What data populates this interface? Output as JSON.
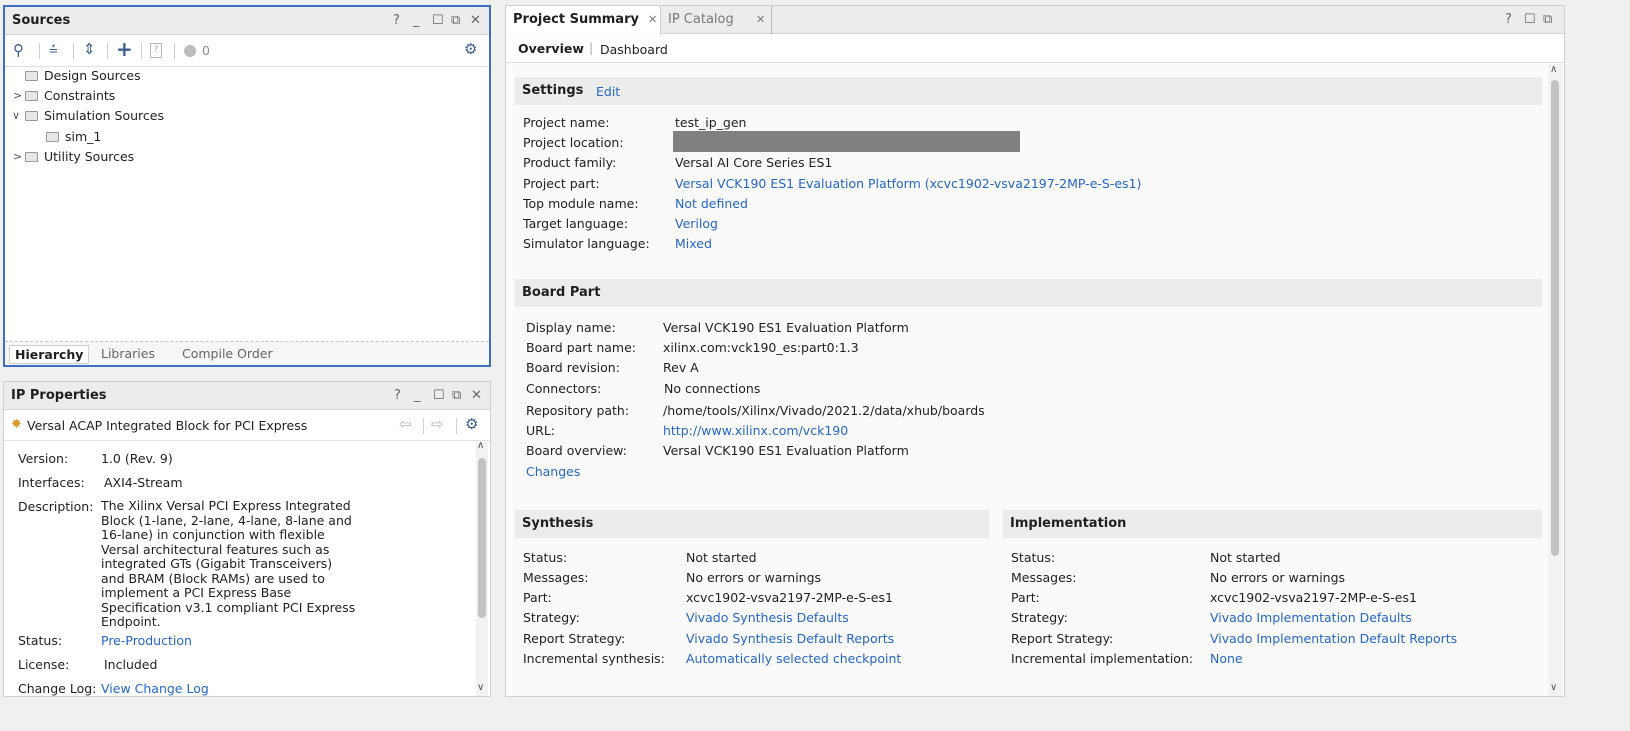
{
  "sources": {
    "title": "Sources",
    "badge_count": "0",
    "tree": [
      {
        "label": "Design Sources"
      },
      {
        "label": "Constraints"
      },
      {
        "label": "Simulation Sources"
      },
      {
        "label": "sim_1"
      },
      {
        "label": "Utility Sources"
      }
    ],
    "bottom_tabs": [
      "Hierarchy",
      "Libraries",
      "Compile Order"
    ]
  },
  "ip_properties": {
    "title": "IP Properties",
    "ip_name": "Versal ACAP Integrated Block for PCI Express",
    "version_label": "Version:",
    "version_value": "1.0 (Rev. 9)",
    "interfaces_label": "Interfaces:",
    "interfaces_value": "AXI4-Stream",
    "description_label": "Description:",
    "description_lines": [
      "The Xilinx Versal PCI Express Integrated",
      "Block (1-lane, 2-lane, 4-lane, 8-lane and",
      "16-lane) in conjunction with flexible",
      "Versal architectural features such as",
      "integrated GTs (Gigabit Transceivers)",
      "and BRAM (Block RAMs) are used to",
      "implement a PCI Express Base",
      "Specification v3.1 compliant PCI Express",
      "Endpoint."
    ],
    "status_label": "Status:",
    "status_value": "Pre-Production",
    "license_label": "License:",
    "license_value": "Included",
    "changelog_label": "Change Log:",
    "changelog_value": "View Change Log"
  },
  "main": {
    "tabs": [
      {
        "label": "Project Summary"
      },
      {
        "label": "IP Catalog"
      }
    ],
    "subtabs": [
      "Overview",
      "Dashboard"
    ],
    "settings": {
      "title": "Settings",
      "edit": "Edit",
      "rows": [
        {
          "label": "Project name:",
          "value": "test_ip_gen"
        },
        {
          "label": "Project location:",
          "value": ""
        },
        {
          "label": "Product family:",
          "value": "Versal AI Core Series ES1"
        },
        {
          "label": "Project part:",
          "value": "Versal VCK190 ES1 Evaluation Platform (xcvc1902-vsva2197-2MP-e-S-es1)"
        },
        {
          "label": "Top module name:",
          "value": "Not defined"
        },
        {
          "label": "Target language:",
          "value": "Verilog"
        },
        {
          "label": "Simulator language:",
          "value": "Mixed"
        }
      ]
    },
    "board": {
      "title": "Board Part",
      "rows": [
        {
          "label": "Display name:",
          "value": "Versal VCK190 ES1 Evaluation Platform"
        },
        {
          "label": "Board part name:",
          "value": "xilinx.com:vck190_es:part0:1.3"
        },
        {
          "label": "Board revision:",
          "value": "Rev A"
        },
        {
          "label": "Connectors:",
          "value": "No connections"
        },
        {
          "label": "Repository path:",
          "value": "/home/tools/Xilinx/Vivado/2021.2/data/xhub/boards"
        },
        {
          "label": "URL:",
          "value": "http://www.xilinx.com/vck190"
        },
        {
          "label": "Board overview:",
          "value": "Versal VCK190 ES1 Evaluation Platform"
        }
      ],
      "changes": "Changes"
    },
    "synthesis": {
      "title": "Synthesis",
      "rows": [
        {
          "label": "Status:",
          "value": "Not started"
        },
        {
          "label": "Messages:",
          "value": "No errors or warnings"
        },
        {
          "label": "Part:",
          "value": "xcvc1902-vsva2197-2MP-e-S-es1"
        },
        {
          "label": "Strategy:",
          "value": "Vivado Synthesis Defaults"
        },
        {
          "label": "Report Strategy:",
          "value": "Vivado Synthesis Default Reports"
        },
        {
          "label": "Incremental synthesis:",
          "value": "Automatically selected checkpoint"
        }
      ]
    },
    "implementation": {
      "title": "Implementation",
      "rows": [
        {
          "label": "Status:",
          "value": "Not started"
        },
        {
          "label": "Messages:",
          "value": "No errors or warnings"
        },
        {
          "label": "Part:",
          "value": "xcvc1902-vsva2197-2MP-e-S-es1"
        },
        {
          "label": "Strategy:",
          "value": "Vivado Implementation Defaults"
        },
        {
          "label": "Report Strategy:",
          "value": "Vivado Implementation Default Reports"
        },
        {
          "label": "Incremental implementation:",
          "value": "None"
        }
      ]
    }
  },
  "colors": {
    "accent": "#3d6fc4",
    "link": "#2566c8"
  }
}
